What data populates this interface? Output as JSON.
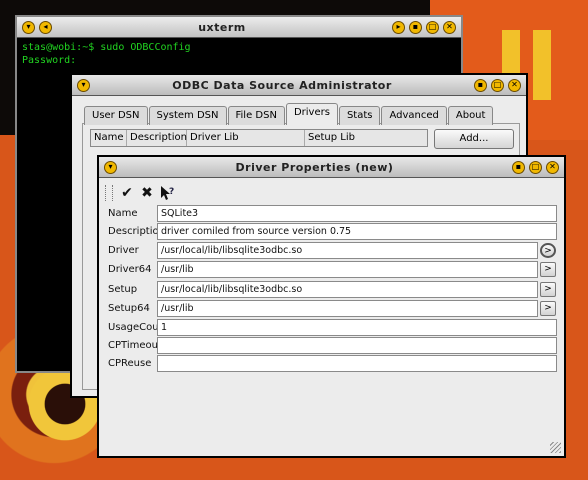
{
  "terminal": {
    "title": "uxterm",
    "lines": [
      "stas@wobi:~$ sudo ODBCConfig",
      "Password:"
    ]
  },
  "admin": {
    "title": "ODBC Data Source Administrator",
    "tabs": [
      "User DSN",
      "System DSN",
      "File DSN",
      "Drivers",
      "Stats",
      "Advanced",
      "About"
    ],
    "active_tab": "Drivers",
    "columns": [
      "Name",
      "Description",
      "Driver Lib",
      "Setup Lib"
    ],
    "add_label": "Add..."
  },
  "props": {
    "title": "Driver Properties (new)",
    "toolbar": {
      "ok_icon": "check-icon",
      "cancel_icon": "x-icon",
      "help_icon": "whats-this-icon"
    },
    "fields": [
      {
        "label": "Name",
        "value": "SQLite3"
      },
      {
        "label": "Description",
        "value": "driver comiled from source version 0.75"
      },
      {
        "label": "Driver",
        "value": "/usr/local/lib/libsqlite3odbc.so"
      },
      {
        "label": "Driver64",
        "value": "/usr/lib"
      },
      {
        "label": "Setup",
        "value": "/usr/local/lib/libsqlite3odbc.so"
      },
      {
        "label": "Setup64",
        "value": "/usr/lib"
      },
      {
        "label": "UsageCount",
        "value": "1"
      },
      {
        "label": "CPTimeout",
        "value": ""
      },
      {
        "label": "CPReuse",
        "value": ""
      }
    ],
    "browse_label": ">"
  },
  "colors": {
    "terminal_text": "#21d321",
    "titlebar_button": "#f1b800",
    "background_orange": "#d8561a"
  }
}
